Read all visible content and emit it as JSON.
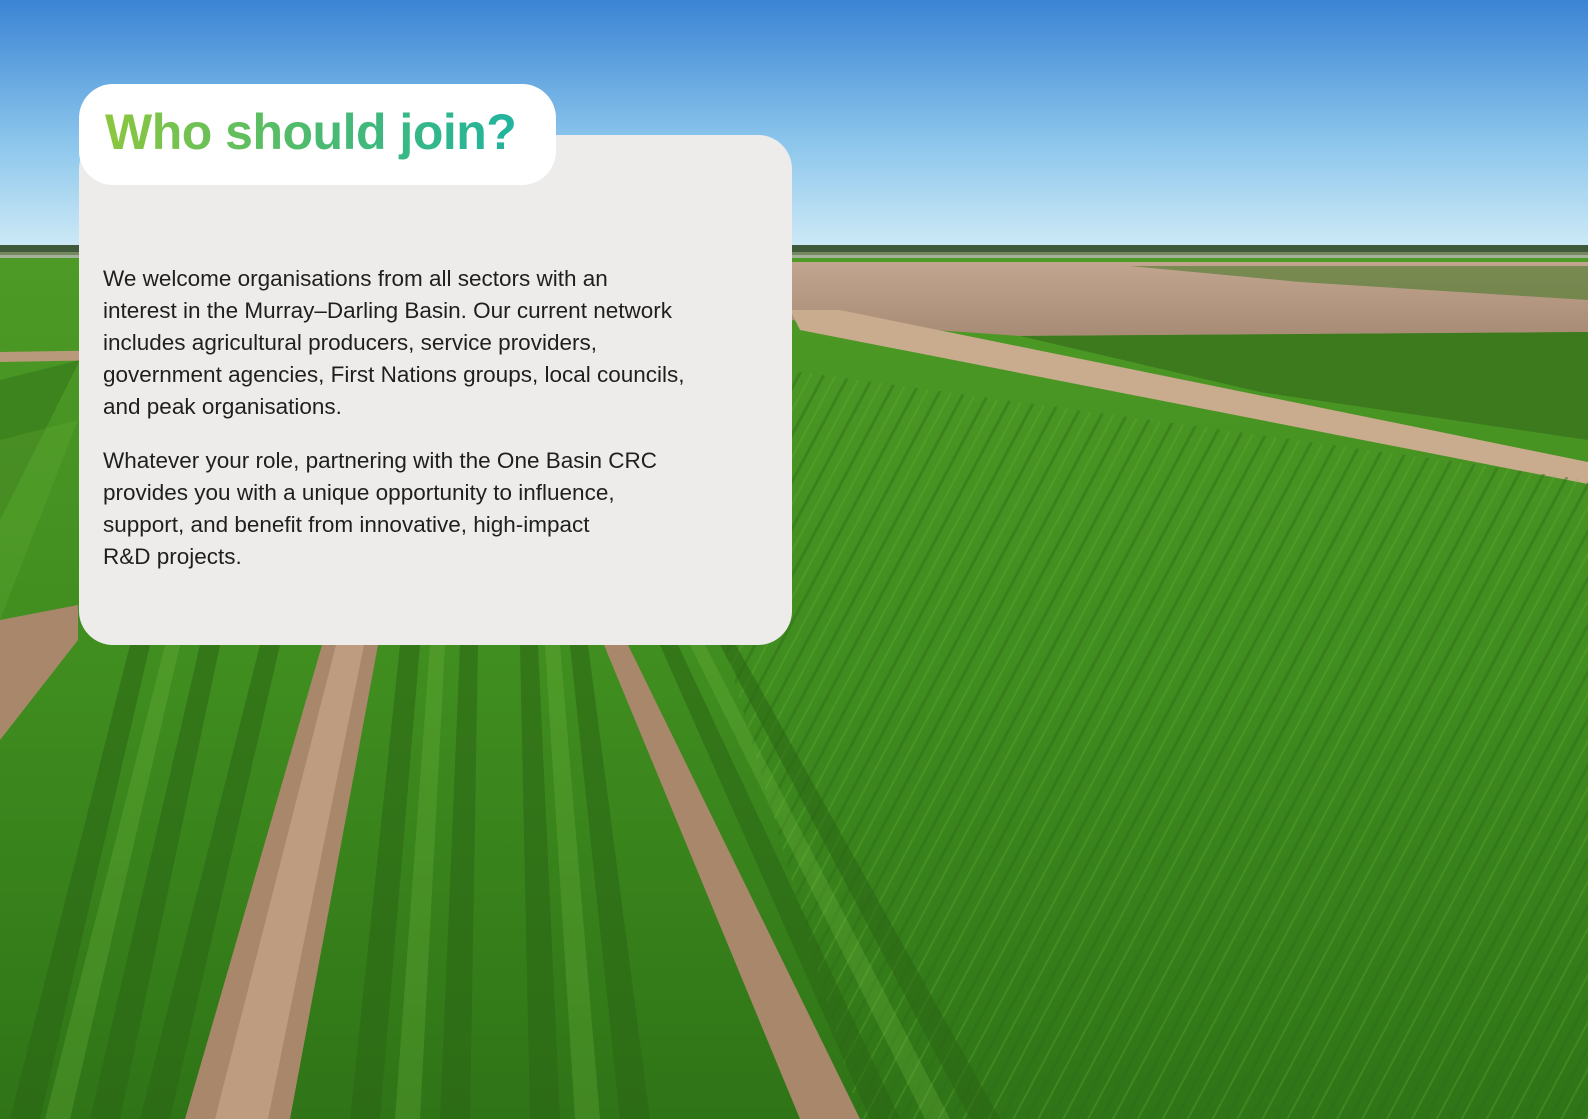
{
  "heading": "Who should join?",
  "paragraphs": [
    {
      "lines": [
        "We welcome organisations from all sectors with an",
        "interest in the Murray–Darling Basin. Our current network",
        "includes agricultural producers, service providers,",
        "government agencies, First Nations groups, local councils,",
        "and peak organisations."
      ]
    },
    {
      "lines": [
        "Whatever your role, partnering with the One Basin CRC",
        "provides you with a unique opportunity to influence,",
        "support, and benefit from innovative, high-impact",
        "R&D projects."
      ]
    }
  ],
  "colors": {
    "card_background": "#edecea",
    "title_gradient_start": "#8cc63f",
    "title_gradient_end": "#19b2a9",
    "body_text": "#1f1f1f",
    "sky_top": "#3d86d6",
    "sky_horizon": "#d3ecf6",
    "crop_green": "#4f9d2a",
    "fallow_brown": "#b79a83"
  },
  "background_image": "aerial photo of green crop fields under a blue sky"
}
